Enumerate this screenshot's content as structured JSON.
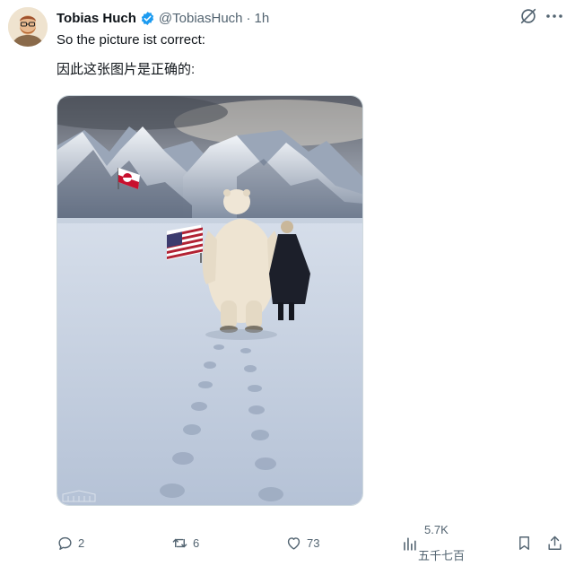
{
  "author": {
    "name": "Tobias Huch",
    "handle": "@TobiasHuch",
    "separator": "·",
    "time": "1h"
  },
  "post": {
    "text_line1": "So the picture ist correct:",
    "text_line2": "因此这张图片是正确的:"
  },
  "actions": {
    "replies": "2",
    "reposts": "6",
    "likes": "73",
    "views": "5.7K",
    "views_caption": "五千七百"
  },
  "icons": [
    "avatar",
    "verified-badge-icon",
    "grok-icon",
    "more-icon",
    "reply-icon",
    "repost-icon",
    "like-icon",
    "views-icon",
    "bookmark-icon",
    "share-icon"
  ],
  "colors": {
    "text_primary": "#0f1419",
    "text_secondary": "#536471",
    "verified_blue": "#1d9bf0"
  }
}
